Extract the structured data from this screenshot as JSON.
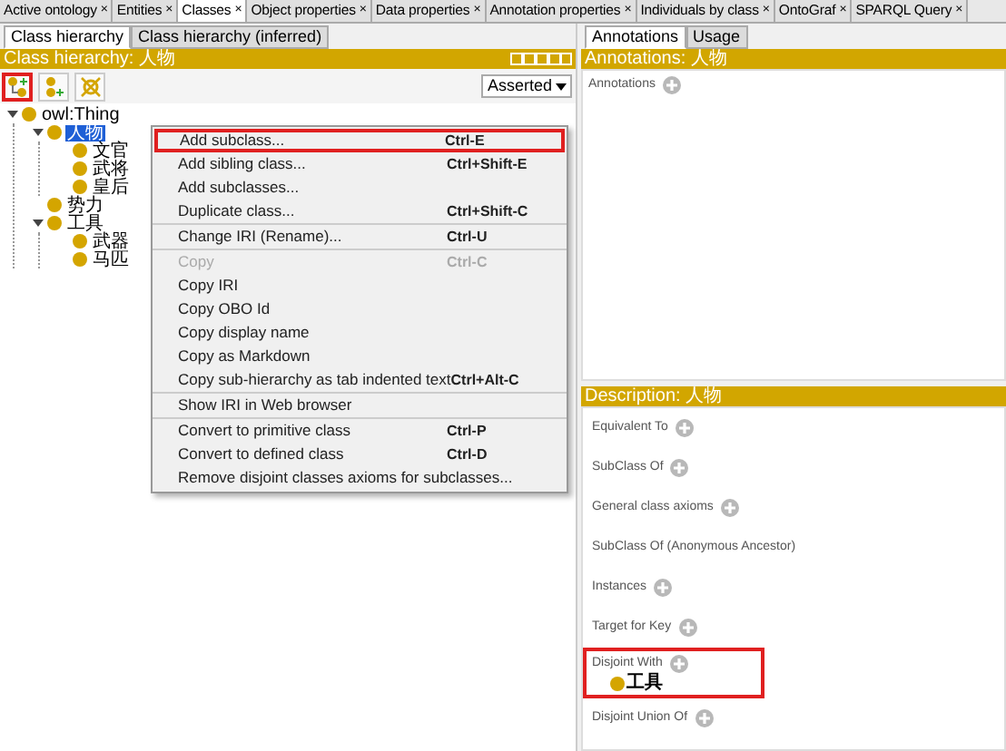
{
  "top_tabs": [
    {
      "label": "Active ontology",
      "close": "×",
      "selected": false
    },
    {
      "label": "Entities",
      "close": "×",
      "selected": false
    },
    {
      "label": "Classes",
      "close": "×",
      "selected": true
    },
    {
      "label": "Object properties",
      "close": "×",
      "selected": false
    },
    {
      "label": "Data properties",
      "close": "×",
      "selected": false
    },
    {
      "label": "Annotation properties",
      "close": "×",
      "selected": false
    },
    {
      "label": "Individuals by class",
      "close": "×",
      "selected": false
    },
    {
      "label": "OntoGraf",
      "close": "×",
      "selected": false
    },
    {
      "label": "SPARQL Query",
      "close": "×",
      "selected": false
    }
  ],
  "left": {
    "tabs": [
      {
        "label": "Class hierarchy",
        "selected": true
      },
      {
        "label": "Class hierarchy (inferred)",
        "selected": false
      }
    ],
    "title": "Class hierarchy: 人物",
    "toolbar": [
      {
        "kind": "add-subclass",
        "highlighted": true
      },
      {
        "kind": "add-sibling",
        "highlighted": false
      },
      {
        "kind": "delete",
        "highlighted": false
      }
    ],
    "view_select": "Asserted",
    "tree": [
      {
        "label": "owl:Thing",
        "selected": false,
        "expanded": true,
        "children": [
          {
            "label": "人物",
            "selected": true,
            "expanded": true,
            "children": [
              {
                "label": "文官",
                "selected": false
              },
              {
                "label": "武将",
                "selected": false
              },
              {
                "label": "皇后",
                "selected": false
              }
            ]
          },
          {
            "label": "势力",
            "selected": false
          },
          {
            "label": "工具",
            "selected": false,
            "expanded": true,
            "children": [
              {
                "label": "武器",
                "selected": false
              },
              {
                "label": "马匹",
                "selected": false
              }
            ]
          }
        ]
      }
    ]
  },
  "context_menu": [
    [
      {
        "label": "Add subclass...",
        "shortcut": "Ctrl-E",
        "highlighted": true,
        "disabled": false
      },
      {
        "label": "Add sibling class...",
        "shortcut": "Ctrl+Shift-E",
        "highlighted": false,
        "disabled": false
      },
      {
        "label": "Add subclasses...",
        "highlighted": false,
        "disabled": false
      },
      {
        "label": "Duplicate class...",
        "shortcut": "Ctrl+Shift-C",
        "highlighted": false,
        "disabled": false
      }
    ],
    [
      {
        "label": "Change IRI (Rename)...",
        "shortcut": "Ctrl-U",
        "highlighted": false,
        "disabled": false
      }
    ],
    [
      {
        "label": "Copy",
        "shortcut": "Ctrl-C",
        "highlighted": false,
        "disabled": true
      },
      {
        "label": "Copy IRI",
        "highlighted": false,
        "disabled": false
      },
      {
        "label": "Copy OBO Id",
        "highlighted": false,
        "disabled": false
      },
      {
        "label": "Copy display name",
        "highlighted": false,
        "disabled": false
      },
      {
        "label": "Copy as Markdown",
        "highlighted": false,
        "disabled": false
      },
      {
        "label": "Copy sub-hierarchy as tab indented text",
        "shortcut": "Ctrl+Alt-C",
        "highlighted": false,
        "disabled": false
      }
    ],
    [
      {
        "label": "Show IRI in Web browser",
        "highlighted": false,
        "disabled": false
      }
    ],
    [
      {
        "label": "Convert to primitive class",
        "shortcut": "Ctrl-P",
        "highlighted": false,
        "disabled": false
      },
      {
        "label": "Convert to defined class",
        "shortcut": "Ctrl-D",
        "highlighted": false,
        "disabled": false
      },
      {
        "label": "Remove disjoint classes axioms for subclasses...",
        "highlighted": false,
        "disabled": false
      }
    ]
  ],
  "right": {
    "tabs": [
      {
        "label": "Annotations",
        "selected": true
      },
      {
        "label": "Usage",
        "selected": false
      }
    ],
    "annotations_title": "Annotations: 人物",
    "annotations_label": "Annotations",
    "description_title": "Description: 人物",
    "sections": [
      {
        "label": "Equivalent To",
        "addable": true,
        "highlighted": false
      },
      {
        "label": "SubClass Of",
        "addable": true,
        "highlighted": false
      },
      {
        "label": "General class axioms",
        "addable": true,
        "highlighted": false
      },
      {
        "label": "SubClass Of (Anonymous Ancestor)",
        "addable": false,
        "highlighted": false
      },
      {
        "label": "Instances",
        "addable": true,
        "highlighted": false
      },
      {
        "label": "Target for Key",
        "addable": true,
        "highlighted": false
      },
      {
        "label": "Disjoint With",
        "addable": true,
        "highlighted": true,
        "items": [
          "工具"
        ]
      },
      {
        "label": "Disjoint Union Of",
        "addable": true,
        "highlighted": false
      }
    ]
  }
}
